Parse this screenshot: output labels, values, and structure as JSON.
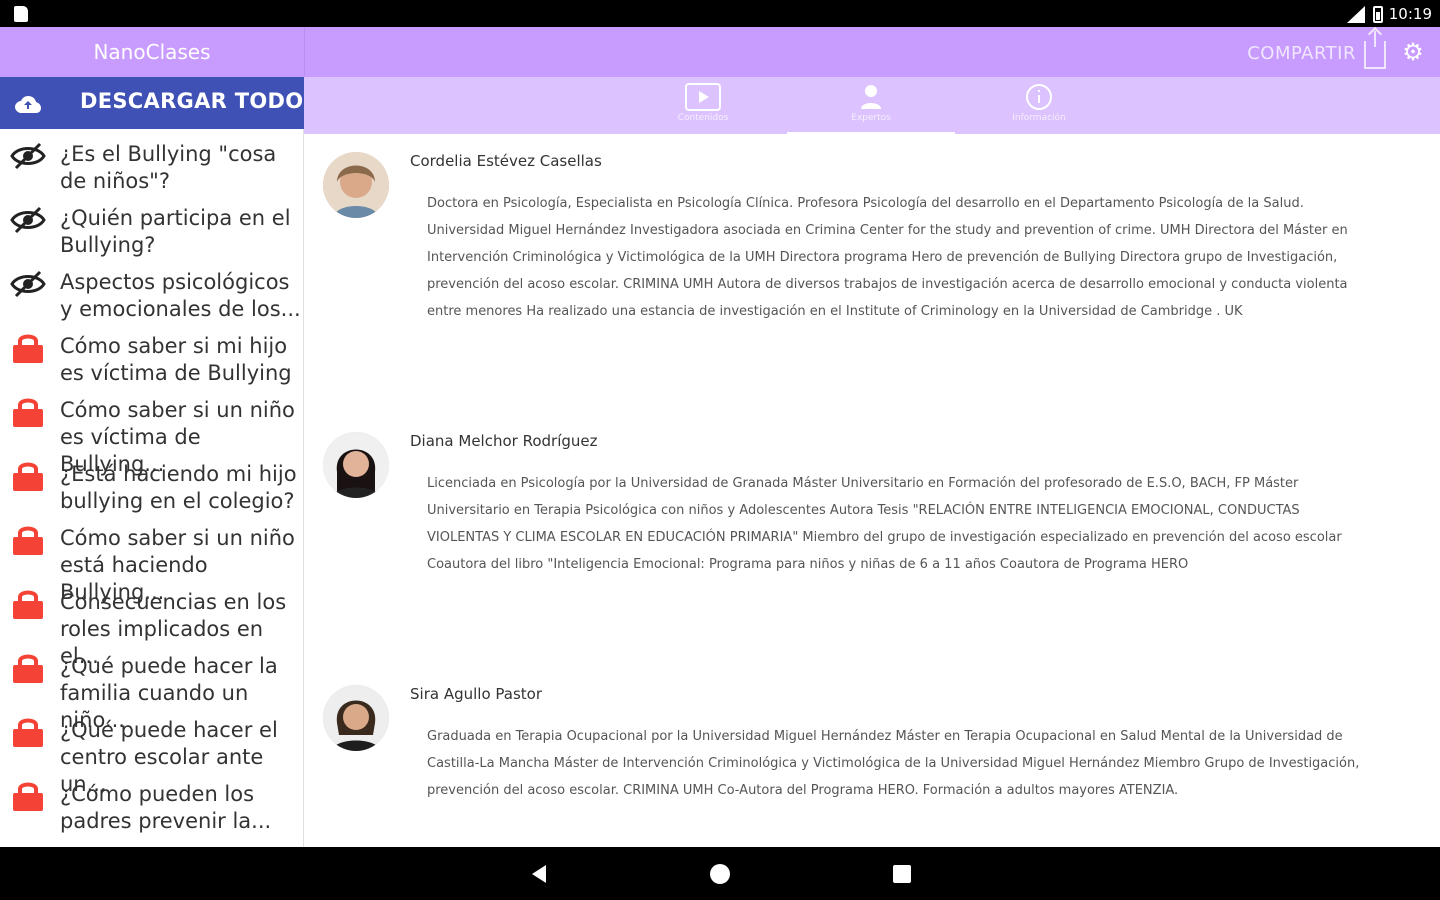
{
  "status_bar": {
    "time": "10:19"
  },
  "app": {
    "title": "NanoClases"
  },
  "header": {
    "share_label": "COMPARTIR"
  },
  "download_all": {
    "label": "DESCARGAR TODO"
  },
  "tabs": [
    {
      "label": "Contenidos",
      "icon": "play-icon"
    },
    {
      "label": "Expertos",
      "icon": "person-icon",
      "active": true
    },
    {
      "label": "Información",
      "icon": "info-icon"
    }
  ],
  "lessons": [
    {
      "title": "¿Es el Bullying \"cosa de niños\"?",
      "state": "viewed"
    },
    {
      "title": "¿Quién participa en el Bullying?",
      "state": "viewed"
    },
    {
      "title": "Aspectos psicológicos y emocionales de los...",
      "state": "viewed"
    },
    {
      "title": "Cómo saber si mi hijo es víctima de Bullying",
      "state": "locked"
    },
    {
      "title": "Cómo saber si un niño es víctima de Bullying...",
      "state": "locked"
    },
    {
      "title": "¿Está haciendo mi hijo bullying en el colegio?",
      "state": "locked"
    },
    {
      "title": "Cómo saber si un niño está haciendo Bullying...",
      "state": "locked"
    },
    {
      "title": "Consecuencias en los roles implicados en el...",
      "state": "locked"
    },
    {
      "title": "¿Qué puede hacer la familia cuando un niño...",
      "state": "locked"
    },
    {
      "title": "¿Qué puede hacer el centro escolar ante un...",
      "state": "locked"
    },
    {
      "title": "¿Cómo pueden los padres prevenir la...",
      "state": "locked"
    }
  ],
  "experts": [
    {
      "name": "Cordelia Estévez Casellas",
      "bio": "Doctora en Psicología, Especialista en Psicología Clínica. Profesora Psicología del desarrollo en el Departamento Psicología de la Salud. Universidad Miguel Hernández Investigadora asociada en Crimina Center for the study and prevention of crime. UMH Directora del Máster en Intervención Criminológica y Victimológica de la UMH Directora programa Hero de prevención de Bullying Directora grupo de Investigación, prevención del acoso escolar. CRIMINA UMH Autora de diversos trabajos de investigación acerca de desarrollo emocional y conducta violenta entre menores Ha realizado una estancia de investigación en el Institute of Criminology en la Universidad de Cambridge . UK"
    },
    {
      "name": "Diana Melchor Rodríguez",
      "bio": "Licenciada en Psicología por la Universidad de Granada Máster Universitario en Formación del profesorado de E.S.O, BACH, FP Máster Universitario en Terapia Psicológica con niños y Adolescentes Autora Tesis \"RELACIÓN ENTRE INTELIGENCIA EMOCIONAL, CONDUCTAS VIOLENTAS Y CLIMA ESCOLAR EN EDUCACIÓN PRIMARIA\" Miembro del grupo de investigación especializado en prevención del acoso escolar Coautora del libro \"Inteligencia Emocional: Programa para niños y niñas de 6 a 11 años Coautora de Programa HERO"
    },
    {
      "name": "Sira Agullo Pastor",
      "bio": "Graduada en Terapia Ocupacional por la Universidad Miguel Hernández Máster en Terapia Ocupacional en Salud Mental de la Universidad de Castilla-La Mancha Máster de Intervención Criminológica y Victimológica de la Universidad Miguel Hernández Miembro Grupo de Investigación, prevención del acoso escolar. CRIMINA UMH Co-Autora del Programa HERO. Formación a adultos mayores ATENZIA."
    }
  ],
  "colors": {
    "header_purple": "#c89bff",
    "tab_bar_purple": "#dcc2ff",
    "download_blue": "#3f51b5",
    "lock_red": "#f44336"
  }
}
